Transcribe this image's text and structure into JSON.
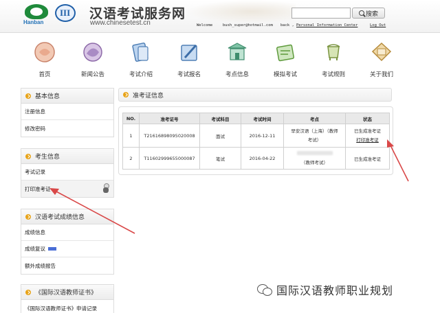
{
  "header": {
    "logo_text": "Hanban",
    "logo2_sub": "汉语考试服务网",
    "title": "汉语考试服务网",
    "url": "www.chinesetest.cn",
    "search_button": "搜索",
    "welcome": "Welcome",
    "email": "bush_super@hotmail.com",
    "back": "back ,",
    "personal_center": "Personal Information Center",
    "logout": "Log Out"
  },
  "nav": [
    {
      "label": "首页",
      "icon": "home-icon"
    },
    {
      "label": "新闻公告",
      "icon": "news-icon"
    },
    {
      "label": "考试介绍",
      "icon": "intro-icon"
    },
    {
      "label": "考试报名",
      "icon": "register-icon"
    },
    {
      "label": "考点信息",
      "icon": "venue-icon"
    },
    {
      "label": "模拟考试",
      "icon": "mock-icon"
    },
    {
      "label": "考试规则",
      "icon": "rules-icon"
    },
    {
      "label": "关于我们",
      "icon": "about-icon"
    }
  ],
  "sidebar": {
    "basic": {
      "title": "基本信息",
      "items": [
        "注册信息",
        "修改密码"
      ]
    },
    "candidate": {
      "title": "考生信息",
      "items": [
        "考试记录",
        "打印准考证"
      ]
    },
    "scores": {
      "title": "汉语考试成绩信息",
      "items": [
        "成绩信息",
        "成绩复议",
        "额外成绩报告"
      ]
    },
    "cert": {
      "title": "《国际汉语教师证书》",
      "items": [
        "《国际汉语教师证书》申请记录"
      ]
    }
  },
  "main": {
    "title": "准考证信息",
    "columns": [
      "NO.",
      "准考证号",
      "考试科目",
      "考试时间",
      "考点",
      "状态"
    ],
    "rows": [
      {
        "no": "1",
        "ticket": "T21616898095020008",
        "subject": "面试",
        "date": "2016-12-11",
        "venue_line1": "早安汉语（上海）（教师",
        "venue_line2": "考试）",
        "status": "已生成准考证",
        "action": "打印准考证"
      },
      {
        "no": "2",
        "ticket": "T11602999655000087",
        "subject": "笔试",
        "date": "2016-04-22",
        "venue_line1": "",
        "venue_line2": "（教师考试）",
        "status": "已生成准考证",
        "action": ""
      }
    ]
  },
  "watermark": "国际汉语教师职业规划",
  "colors": {
    "accent": "#e8a317",
    "arrow": "#d94848",
    "link_badge": "#4a6ed6"
  }
}
